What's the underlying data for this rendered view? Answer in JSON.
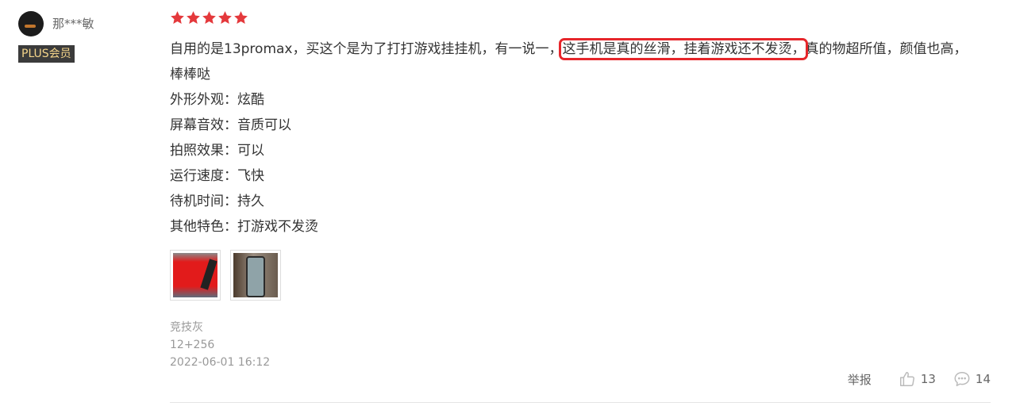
{
  "review": {
    "username": "那***敏",
    "badge": "PLUS会员",
    "rating": 5,
    "content": {
      "before_highlight": "自用的是13promax，买这个是为了打打游戏挂挂机，有一说一，",
      "highlight": "这手机是真的丝滑，挂着游戏还不发烫，",
      "after_highlight": "真的物超所值，颜值也高，棒棒哒"
    },
    "attributes": [
      {
        "text": "外形外观：炫酷"
      },
      {
        "text": "屏幕音效：音质可以"
      },
      {
        "text": "拍照效果：可以"
      },
      {
        "text": "运行速度：飞快"
      },
      {
        "text": "待机时间：持久"
      },
      {
        "text": "其他特色：打游戏不发烫"
      }
    ],
    "color": "竞技灰",
    "spec": "12+256",
    "date": "2022-06-01 16:12",
    "report_label": "举报",
    "likes": "13",
    "comments": "14"
  },
  "colors": {
    "star": "#e4393c",
    "highlight_box": "#e6262b",
    "badge_bg": "#3b3b3b",
    "badge_text": "#f5d58a"
  }
}
